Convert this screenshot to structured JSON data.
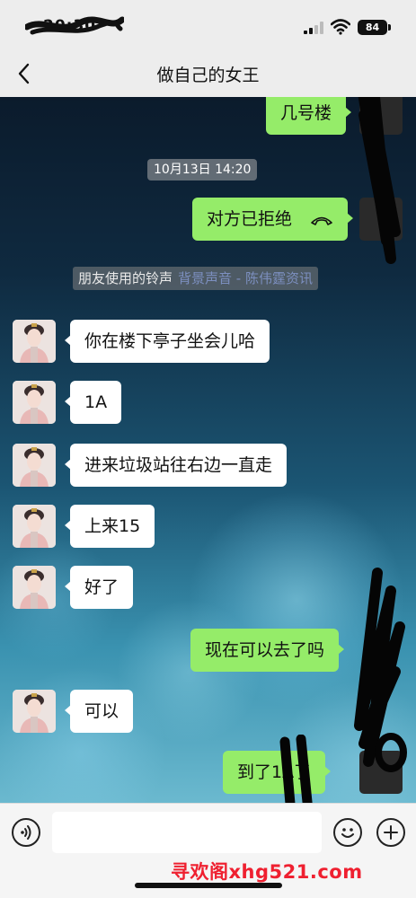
{
  "status_bar": {
    "time": "20:30",
    "battery": "84"
  },
  "nav": {
    "title": "做自己的女王"
  },
  "chat": {
    "msg_building": "几号楼",
    "timestamp": "10月13日 14:20",
    "call_status": "对方已拒绝",
    "ringtone_label": "朋友使用的铃声",
    "ringtone_link": "背景声音 - 陈伟霆资讯",
    "msg_1": "你在楼下亭子坐会儿哈",
    "msg_2": "1A",
    "msg_3": "进来垃圾站往右边一直走",
    "msg_4": "上来15",
    "msg_5": "好了",
    "msg_6": "现在可以去了吗",
    "msg_7": "可以",
    "msg_8": "到了1A了"
  },
  "input": {
    "placeholder": ""
  },
  "watermark": "寻欢阁xhg521.com",
  "colors": {
    "sent_bubble": "#95ec69",
    "received_bubble": "#ffffff",
    "watermark": "#ef2030"
  }
}
